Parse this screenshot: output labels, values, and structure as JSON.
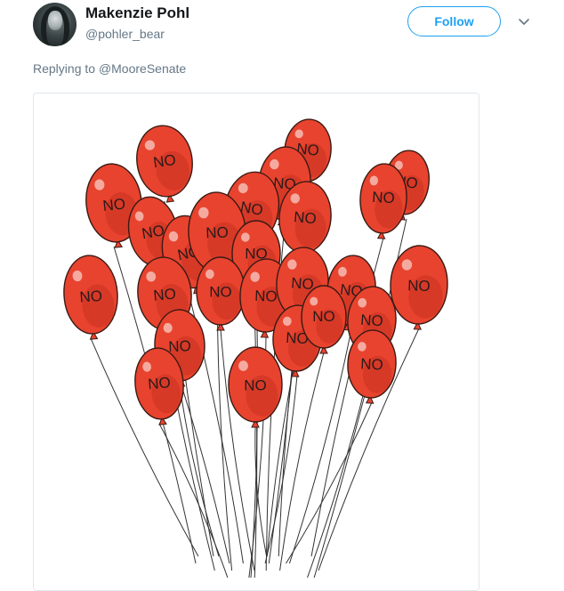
{
  "tweet": {
    "author": {
      "name": "Makenzie Pohl",
      "handle": "@pohler_bear"
    },
    "follow_label": "Follow",
    "reply": {
      "prefix": "Replying to",
      "mention": "@MooreSenate"
    },
    "image": {
      "description_icon": "balloons-illustration",
      "balloon_label": "NO",
      "colors": {
        "balloon": "#e8432e",
        "balloon_dark": "#b8281b",
        "outline": "#3a1a14",
        "string": "#333333"
      }
    }
  },
  "colors": {
    "accent": "#1da1f2",
    "secondary_text": "#657786",
    "border": "#e1e8ed"
  }
}
